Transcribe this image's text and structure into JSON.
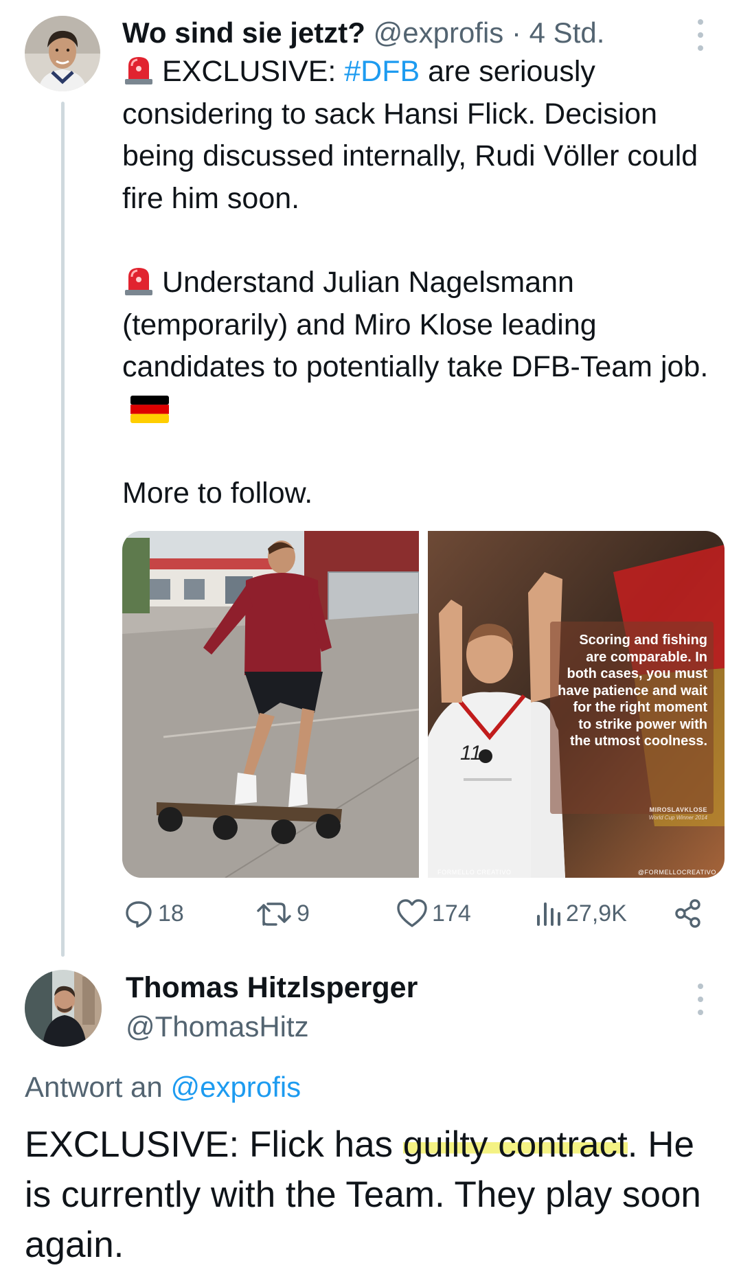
{
  "tweet1": {
    "author_name": "Wo sind sie jetzt?",
    "author_handle": "@exprofis",
    "separator": "·",
    "timestamp": "4 Std.",
    "para1_before_hashtag": "EXCLUSIVE: ",
    "hashtag": "#DFB",
    "para1_after_hashtag": " are seriously considering to sack Hansi Flick. Decision being discussed internally, Rudi Völler could fire him soon.",
    "para2": "Understand Julian Nagelsmann (temporarily) and Miro Klose leading candidates to potentially take DFB-Team job.",
    "para3": "More to follow.",
    "emoji_siren": "police-car-light-emoji",
    "emoji_flag": "germany-flag-emoji",
    "image_quote": "Scoring and fishing are comparable. In both cases, you must have patience and wait for the right moment to strike power with the utmost coolness.",
    "image_quote_author": "MIROSLAVKLOSE",
    "image_quote_sub": "World Cup Winner 2014",
    "image_footer_left": "FORMELLO CREATIVO",
    "image_footer_right": "@FORMELLOCREATIVO",
    "jersey_number": "11",
    "stats": {
      "replies": "18",
      "retweets": "9",
      "likes": "174",
      "views": "27,9K"
    }
  },
  "tweet2": {
    "author_name": "Thomas Hitzlsperger",
    "author_handle": "@ThomasHitz",
    "reply_prefix": "Antwort an ",
    "reply_mention": "@exprofis",
    "text_before": "EXCLUSIVE: Flick has ",
    "text_highlight": "guilty contract",
    "text_after": ". He is currently with the Team. They play soon again."
  },
  "colors": {
    "text_primary": "#0f1419",
    "text_secondary": "#536471",
    "link": "#1d9bf0",
    "thread_line": "#cfd9de",
    "highlight": "#f1ed5a"
  }
}
